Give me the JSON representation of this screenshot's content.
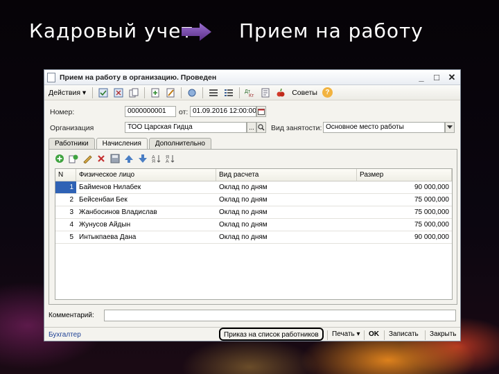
{
  "slide": {
    "title_left": "Кадровый учет",
    "title_right": "Прием на работу"
  },
  "window": {
    "title": "Прием на работу в организацию. Проведен",
    "controls": [
      "_",
      "□",
      "✕"
    ]
  },
  "toolbar": {
    "actions_label": "Действия ▾",
    "tips_label": "Советы",
    "help_label": "?"
  },
  "form": {
    "number_label": "Номер:",
    "number_value": "0000000001",
    "date_label": "от:",
    "date_value": "01.09.2016 12:00:00",
    "org_label": "Организация",
    "org_value": "ТОО Царская Гидца",
    "org_btn": "...",
    "employment_label": "Вид занятости:",
    "employment_value": "Основное место работы"
  },
  "tabs": [
    {
      "label": "Работники"
    },
    {
      "label": "Начисления"
    },
    {
      "label": "Дополнительно"
    }
  ],
  "grid": {
    "columns": [
      "N",
      "Физическое лицо",
      "Вид расчета",
      "Размер"
    ],
    "rows": [
      {
        "n": "1",
        "name": "Байменов Нилабек",
        "calc": "Оклад по дням",
        "size": "90 000,000"
      },
      {
        "n": "2",
        "name": "Бейсенбаи Бек",
        "calc": "Оклад по дням",
        "size": "75 000,000"
      },
      {
        "n": "3",
        "name": "Жанбосинов Владислав",
        "calc": "Оклад по дням",
        "size": "75 000,000"
      },
      {
        "n": "4",
        "name": "Жунусов Айдын",
        "calc": "Оклад по дням",
        "size": "75 000,000"
      },
      {
        "n": "5",
        "name": "Интыкпаева Дана",
        "calc": "Оклад по дням",
        "size": "90 000,000"
      }
    ]
  },
  "comment": {
    "label": "Комментарий:",
    "value": ""
  },
  "bottom": {
    "link": "Бухгалтер",
    "order_btn": "Приказ на список работников",
    "print_btn": "Печать ▾",
    "ok_btn": "OK",
    "save_btn": "Записать",
    "close_btn": "Закрыть"
  },
  "colors": {
    "accent_arrow": "#7b4fa8",
    "selected_row": "#2f62b5"
  }
}
